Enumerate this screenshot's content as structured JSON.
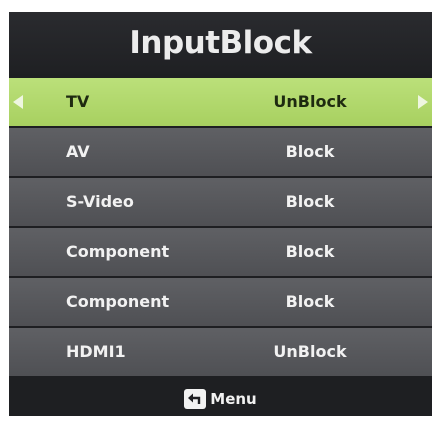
{
  "screen": {
    "title": "InputBlock",
    "rows": [
      {
        "label": "TV",
        "value": "UnBlock",
        "selected": true
      },
      {
        "label": "AV",
        "value": "Block",
        "selected": false
      },
      {
        "label": "S-Video",
        "value": "Block",
        "selected": false
      },
      {
        "label": "Component",
        "value": "Block",
        "selected": false
      },
      {
        "label": "Component",
        "value": "Block",
        "selected": false
      },
      {
        "label": "HDMI1",
        "value": "UnBlock",
        "selected": false
      }
    ],
    "footer": {
      "menu_icon": "return-arrow-icon",
      "menu_label": "Menu"
    }
  },
  "colors": {
    "background": "#1e1f22",
    "row": "#57585c",
    "selected_row": "#b2d86c",
    "text": "#f2f2f2"
  }
}
